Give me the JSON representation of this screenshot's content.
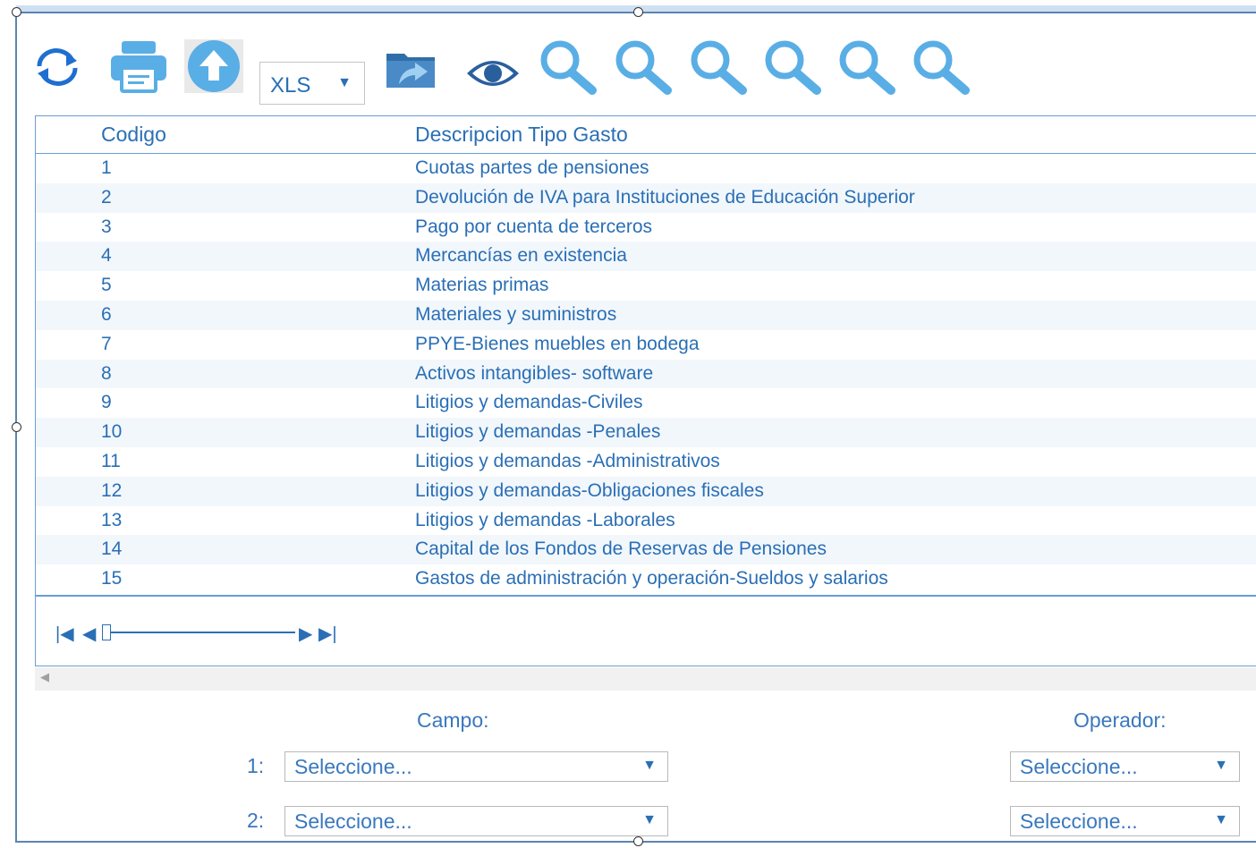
{
  "toolbar": {
    "format_value": "XLS",
    "icons": [
      "refresh-icon",
      "print-icon",
      "upload-icon",
      "format-select",
      "export-icon",
      "view-icon",
      "search-icon",
      "search-icon",
      "search-icon",
      "search-icon",
      "search-icon",
      "search-icon"
    ]
  },
  "grid": {
    "headers": {
      "code": "Codigo",
      "description": "Descripcion Tipo Gasto"
    },
    "rows": [
      {
        "code": "1",
        "description": "Cuotas partes de pensiones"
      },
      {
        "code": "2",
        "description": "Devolución de IVA para Instituciones de Educación Superior"
      },
      {
        "code": "3",
        "description": "Pago por cuenta de terceros"
      },
      {
        "code": "4",
        "description": "Mercancías en existencia"
      },
      {
        "code": "5",
        "description": "Materias primas"
      },
      {
        "code": "6",
        "description": "Materiales y suministros"
      },
      {
        "code": "7",
        "description": "PPYE-Bienes muebles en bodega"
      },
      {
        "code": "8",
        "description": "Activos intangibles- software"
      },
      {
        "code": "9",
        "description": "Litigios y demandas-Civiles"
      },
      {
        "code": "10",
        "description": "Litigios y demandas -Penales"
      },
      {
        "code": "11",
        "description": "Litigios y demandas -Administrativos"
      },
      {
        "code": "12",
        "description": "Litigios y demandas-Obligaciones fiscales"
      },
      {
        "code": "13",
        "description": "Litigios y demandas -Laborales"
      },
      {
        "code": "14",
        "description": "Capital de los Fondos de Reservas de Pensiones"
      },
      {
        "code": "15",
        "description": "Gastos de administración y operación-Sueldos y salarios"
      }
    ]
  },
  "filters": {
    "campo_label": "Campo:",
    "operador_label": "Operador:",
    "row1_label": "1:",
    "row2_label": "2:",
    "campo1_value": "Seleccione...",
    "campo2_value": "Seleccione...",
    "operador1_value": "Seleccione...",
    "operador2_value": "Seleccione..."
  },
  "colors": {
    "accent": "#2a6fb5",
    "icon_blue": "#5aaee6",
    "border": "#6a9ed3"
  }
}
